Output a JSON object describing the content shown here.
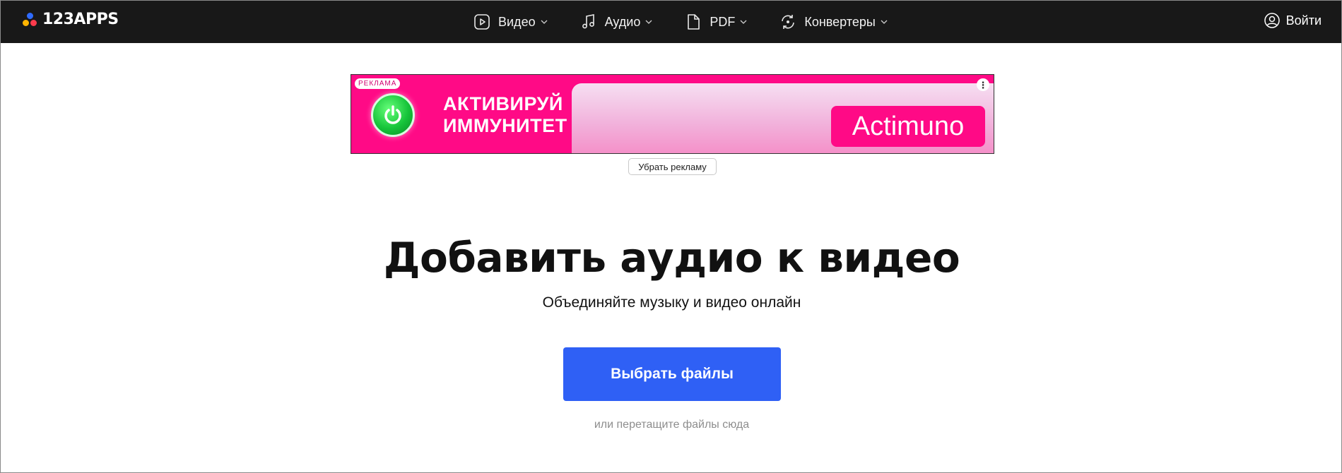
{
  "header": {
    "logo_text": "123APPS",
    "nav": [
      {
        "label": "Видео",
        "icon": "play-circle-icon"
      },
      {
        "label": "Аудио",
        "icon": "music-note-icon"
      },
      {
        "label": "PDF",
        "icon": "document-icon"
      },
      {
        "label": "Конвертеры",
        "icon": "convert-icon"
      }
    ],
    "login_label": "Войти"
  },
  "ad": {
    "badge": "РЕКЛАМА",
    "slogan_line1": "АКТИВИРУЙ",
    "slogan_line2": "ИММУНИТЕТ",
    "brand": "Actimuno",
    "remove_label": "Убрать рекламу",
    "colors": {
      "background": "#ff0a86",
      "power_button": "#16c43a"
    }
  },
  "hero": {
    "title": "Добавить аудио к видео",
    "subtitle": "Объединяйте музыку и видео онлайн",
    "choose_button": "Выбрать файлы",
    "drop_hint": "или перетащите файлы сюда"
  },
  "colors": {
    "header_bg": "#181818",
    "primary_button": "#2f60f5"
  }
}
